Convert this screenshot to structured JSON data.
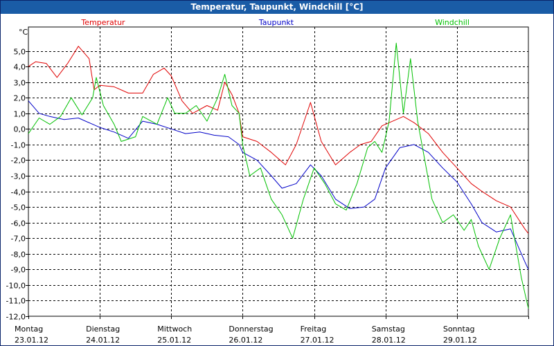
{
  "window": {
    "title": "Temperatur, Taupunkt, Windchill [°C]"
  },
  "chart_data": {
    "type": "line",
    "title": "Temperatur, Taupunkt, Windchill [°C]",
    "ylabel": "°C",
    "ylim": [
      -12,
      6
    ],
    "yticks": [
      5,
      4,
      3,
      2,
      1,
      0,
      -1,
      -2,
      -3,
      -4,
      -5,
      -6,
      -7,
      -8,
      -9,
      -10,
      -11,
      -12
    ],
    "ytick_labels": [
      "5,0",
      "4,0",
      "3,0",
      "2,0",
      "1,0",
      "0,0",
      "-1,0",
      "-2,0",
      "-3,0",
      "-4,0",
      "-5,0",
      "-6,0",
      "-7,0",
      "-8,0",
      "-9,0",
      "-10,0",
      "-11,0",
      "-12,0"
    ],
    "xlim": [
      0,
      7
    ],
    "x_ticks": [
      0,
      1,
      2,
      3,
      4,
      5,
      6,
      7
    ],
    "days": [
      {
        "weekday": "Montag",
        "date": "23.01.12"
      },
      {
        "weekday": "Dienstag",
        "date": "24.01.12"
      },
      {
        "weekday": "Mittwoch",
        "date": "25.01.12"
      },
      {
        "weekday": "Donnerstag",
        "date": "26.01.12"
      },
      {
        "weekday": "Freitag",
        "date": "27.01.12"
      },
      {
        "weekday": "Samstag",
        "date": "28.01.12"
      },
      {
        "weekday": "Sonntag",
        "date": "29.01.12"
      }
    ],
    "grid": true,
    "legend_position": "top",
    "series": [
      {
        "name": "Temperatur",
        "color": "#e00000",
        "x": [
          0,
          0.1,
          0.25,
          0.4,
          0.55,
          0.7,
          0.85,
          0.92,
          1.0,
          1.2,
          1.4,
          1.6,
          1.75,
          1.9,
          2.0,
          2.15,
          2.3,
          2.5,
          2.65,
          2.75,
          2.85,
          2.95,
          3.0,
          3.2,
          3.4,
          3.6,
          3.75,
          3.95,
          4.1,
          4.3,
          4.5,
          4.65,
          4.8,
          4.95,
          5.1,
          5.25,
          5.4,
          5.6,
          5.8,
          6.0,
          6.2,
          6.35,
          6.55,
          6.75,
          6.95,
          7.0
        ],
        "y": [
          4.0,
          4.3,
          4.2,
          3.3,
          4.2,
          5.3,
          4.5,
          2.5,
          2.8,
          2.7,
          2.3,
          2.3,
          3.5,
          3.9,
          3.4,
          1.8,
          1.0,
          1.5,
          1.2,
          3.0,
          2.2,
          1.0,
          -0.5,
          -0.8,
          -1.5,
          -2.3,
          -1.0,
          1.7,
          -0.8,
          -2.3,
          -1.5,
          -1.0,
          -0.8,
          0.2,
          0.5,
          0.8,
          0.4,
          -0.3,
          -1.5,
          -2.5,
          -3.5,
          -4.0,
          -4.6,
          -5.0,
          -6.4,
          -6.7
        ]
      },
      {
        "name": "Taupunkt",
        "color": "#0000c8",
        "x": [
          0,
          0.15,
          0.3,
          0.5,
          0.7,
          0.9,
          1.0,
          1.2,
          1.4,
          1.6,
          1.8,
          2.0,
          2.2,
          2.4,
          2.6,
          2.8,
          2.95,
          3.0,
          3.2,
          3.4,
          3.55,
          3.75,
          3.95,
          4.1,
          4.3,
          4.5,
          4.7,
          4.85,
          5.0,
          5.2,
          5.4,
          5.6,
          5.8,
          6.0,
          6.2,
          6.35,
          6.55,
          6.75,
          6.95,
          7.0
        ],
        "y": [
          1.8,
          1.0,
          0.8,
          0.6,
          0.7,
          0.3,
          0.1,
          -0.2,
          -0.6,
          0.5,
          0.3,
          0.0,
          -0.3,
          -0.2,
          -0.4,
          -0.5,
          -1.0,
          -1.5,
          -2.0,
          -3.0,
          -3.8,
          -3.5,
          -2.3,
          -3.0,
          -4.5,
          -5.1,
          -5.0,
          -4.5,
          -2.5,
          -1.2,
          -1.0,
          -1.5,
          -2.5,
          -3.4,
          -4.8,
          -6.0,
          -6.6,
          -6.4,
          -8.5,
          -9.0
        ]
      },
      {
        "name": "Windchill",
        "color": "#00c000",
        "x": [
          0,
          0.15,
          0.3,
          0.45,
          0.6,
          0.75,
          0.9,
          0.95,
          1.05,
          1.2,
          1.3,
          1.5,
          1.6,
          1.8,
          1.95,
          2.05,
          2.2,
          2.35,
          2.5,
          2.65,
          2.75,
          2.85,
          2.95,
          3.0,
          3.1,
          3.25,
          3.4,
          3.55,
          3.7,
          3.85,
          4.0,
          4.15,
          4.3,
          4.45,
          4.6,
          4.75,
          4.85,
          4.95,
          5.05,
          5.15,
          5.25,
          5.35,
          5.45,
          5.55,
          5.65,
          5.8,
          5.95,
          6.1,
          6.2,
          6.3,
          6.45,
          6.6,
          6.75,
          6.9,
          7.0
        ],
        "y": [
          -0.3,
          0.7,
          0.3,
          0.8,
          2.0,
          0.9,
          2.0,
          3.3,
          1.5,
          0.3,
          -0.8,
          -0.5,
          0.8,
          0.3,
          2.0,
          1.0,
          1.0,
          1.5,
          0.5,
          2.0,
          3.5,
          1.5,
          1.0,
          -1.0,
          -3.0,
          -2.5,
          -4.5,
          -5.5,
          -7.0,
          -4.5,
          -2.5,
          -3.5,
          -4.8,
          -5.2,
          -3.5,
          -1.2,
          -0.8,
          -1.5,
          0.5,
          5.5,
          1.0,
          4.5,
          0.5,
          -2.0,
          -4.5,
          -6.0,
          -5.5,
          -6.5,
          -5.8,
          -7.5,
          -9.0,
          -7.0,
          -5.5,
          -9.5,
          -11.5
        ]
      }
    ]
  }
}
